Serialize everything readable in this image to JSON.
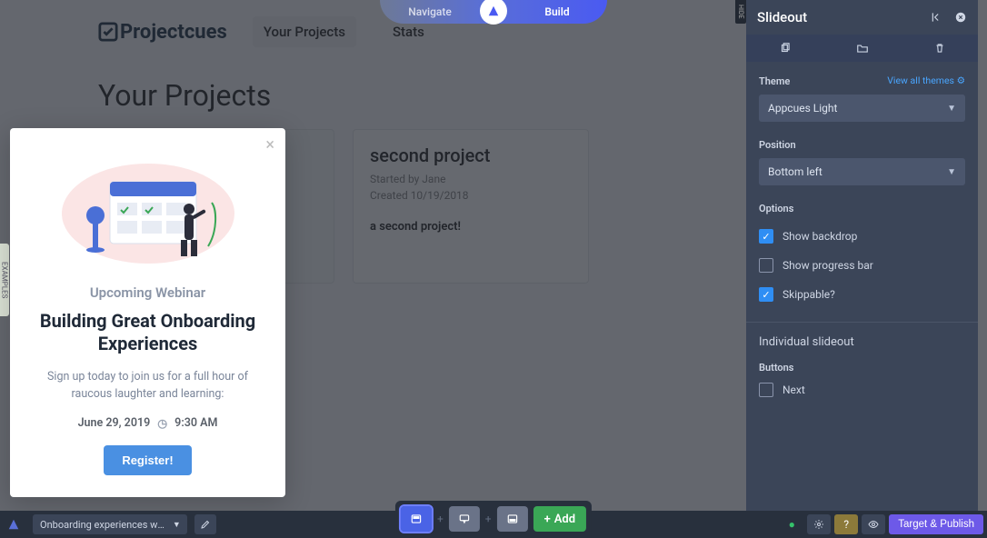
{
  "app": {
    "logo_text": "Projectcues",
    "nav": {
      "your_projects": "Your Projects",
      "stats": "Stats"
    },
    "page_title": "Your Projects"
  },
  "project_card": {
    "title": "second project",
    "started_by": "Started by Jane",
    "created": "Created 10/19/2018",
    "description": "a second project!"
  },
  "mode": {
    "navigate": "Navigate",
    "build": "Build"
  },
  "modal": {
    "eyebrow": "Upcoming Webinar",
    "heading": "Building Great Onboarding Experiences",
    "body": "Sign up today to join us for a full hour of raucous laughter and learning:",
    "date": "June 29, 2019",
    "time": "9:30 AM",
    "cta": "Register!"
  },
  "panel": {
    "title": "Slideout",
    "theme_label": "Theme",
    "themes_link": "View all themes",
    "theme_value": "Appcues Light",
    "position_label": "Position",
    "position_value": "Bottom left",
    "options_label": "Options",
    "opt_backdrop": "Show backdrop",
    "opt_progress": "Show progress bar",
    "opt_skippable": "Skippable?",
    "individual_heading": "Individual slideout",
    "buttons_label": "Buttons",
    "btn_next": "Next"
  },
  "bottombar": {
    "flow_name": "Onboarding experiences webi…",
    "add": "Add",
    "publish": "Target & Publish"
  },
  "hide_label": "HIDE",
  "left_tab": "EXAMPLES"
}
